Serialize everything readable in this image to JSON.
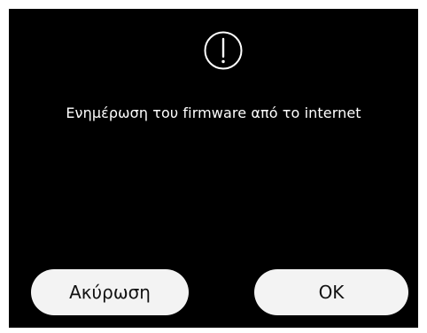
{
  "dialog": {
    "icon": "exclamation-circle-icon",
    "message": "Ενημέρωση του firmware από το internet",
    "cancel_label": "Ακύρωση",
    "ok_label": "OK"
  },
  "colors": {
    "background": "#000000",
    "text": "#ffffff",
    "button_bg": "#f3f3f3",
    "button_text": "#111111"
  }
}
